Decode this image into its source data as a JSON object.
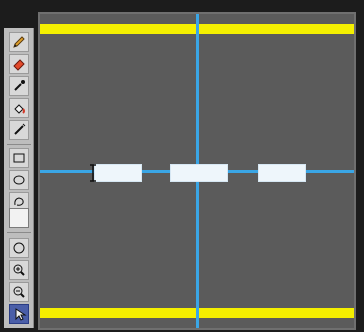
{
  "app": {
    "tools": [
      {
        "name": "pencil-icon",
        "label": ""
      },
      {
        "name": "eraser-icon",
        "label": ""
      },
      {
        "name": "eyedropper-icon",
        "label": ""
      },
      {
        "name": "paint-bucket-icon",
        "label": ""
      },
      {
        "name": "wand-icon",
        "label": ""
      },
      {
        "name": "rectangle-icon",
        "label": ""
      },
      {
        "name": "ellipse-icon",
        "label": ""
      },
      {
        "name": "lasso-icon",
        "label": ""
      },
      {
        "name": "circle-tool-icon",
        "label": ""
      },
      {
        "name": "zoom-in-icon",
        "label": ""
      },
      {
        "name": "zoom-out-icon",
        "label": ""
      },
      {
        "name": "pointer-icon",
        "label": ""
      }
    ],
    "colors": {
      "canvas_bg": "#5b5b5b",
      "lane_yellow": "#f4ef00",
      "guide_blue": "#3aa6e6",
      "dash_white": "#eef6fb"
    },
    "selected_tool": "pointer-icon"
  }
}
